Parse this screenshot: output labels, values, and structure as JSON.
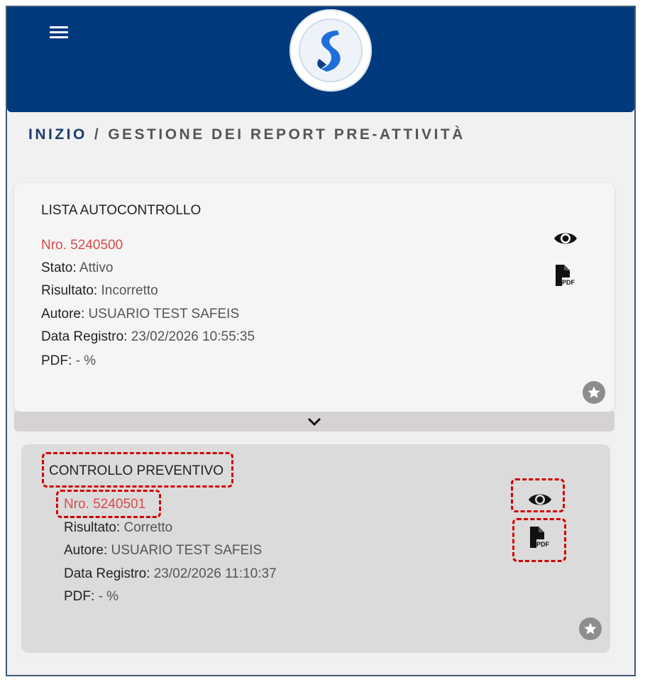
{
  "header": {
    "menu_icon": "hamburger-icon",
    "logo_icon": "safeis-logo"
  },
  "breadcrumb": {
    "home": "INIZIO",
    "separator": "/",
    "current": "GESTIONE DEI REPORT PRE-ATTIVITÀ"
  },
  "cards": [
    {
      "title": "LISTA AUTOCONTROLLO",
      "number": "Nro. 5240500",
      "fields": [
        {
          "label": "Stato:",
          "value": "Attivo"
        },
        {
          "label": "Risultato:",
          "value": "Incorretto"
        },
        {
          "label": "Autore:",
          "value": "USUARIO TEST SAFEIS"
        },
        {
          "label": "Data Registro:",
          "value": "23/02/2026 10:55:35"
        },
        {
          "label": "PDF:",
          "value": "- %"
        }
      ],
      "actions": [
        "eye-icon",
        "pdf-icon",
        "star-icon"
      ]
    },
    {
      "title": "CONTROLLO PREVENTIVO",
      "number": "Nro. 5240501",
      "fields": [
        {
          "label": "Risultato:",
          "value": "Corretto"
        },
        {
          "label": "Autore:",
          "value": "USUARIO TEST SAFEIS"
        },
        {
          "label": "Data Registro:",
          "value": "23/02/2026 11:10:37"
        },
        {
          "label": "PDF:",
          "value": "- %"
        }
      ],
      "actions": [
        "eye-icon",
        "pdf-icon",
        "star-icon"
      ]
    }
  ],
  "colors": {
    "header": "#003a7d",
    "number": "#d84a4a",
    "highlight": "#d10000"
  }
}
